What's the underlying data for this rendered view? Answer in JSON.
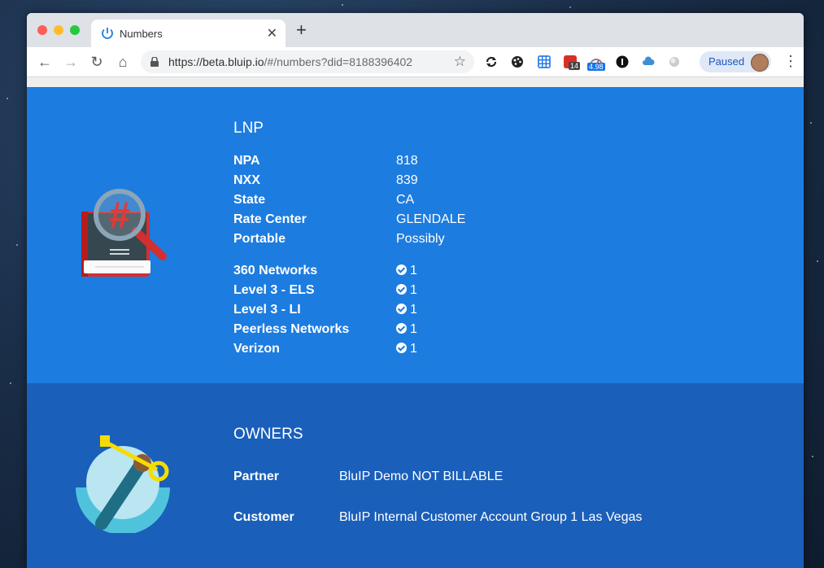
{
  "browser": {
    "tab_title": "Numbers",
    "url_host": "https://beta.bluip.io",
    "url_path": "/#/numbers?did=8188396402",
    "profile_status": "Paused",
    "extensions": [
      {
        "name": "sync-icon"
      },
      {
        "name": "palette-icon"
      },
      {
        "name": "grid-icon"
      },
      {
        "name": "calendar-icon",
        "badge": "14"
      },
      {
        "name": "gauge-icon",
        "badge": "4.98"
      },
      {
        "name": "onepassword-icon"
      },
      {
        "name": "cloud-icon"
      },
      {
        "name": "circle-icon"
      }
    ]
  },
  "lnp": {
    "title": "LNP",
    "fields": [
      {
        "label": "NPA",
        "value": "818"
      },
      {
        "label": "NXX",
        "value": "839"
      },
      {
        "label": "State",
        "value": "CA"
      },
      {
        "label": "Rate Center",
        "value": "GLENDALE"
      },
      {
        "label": "Portable",
        "value": "Possibly"
      }
    ],
    "carriers": [
      {
        "label": "360 Networks",
        "value": "1"
      },
      {
        "label": "Level 3 - ELS",
        "value": "1"
      },
      {
        "label": "Level 3 - LI",
        "value": "1"
      },
      {
        "label": "Peerless Networks",
        "value": "1"
      },
      {
        "label": "Verizon",
        "value": "1"
      }
    ]
  },
  "owners": {
    "title": "OWNERS",
    "partner_label": "Partner",
    "partner_value": "BluIP Demo NOT BILLABLE",
    "customer_label": "Customer",
    "customer_value": "BluIP Internal Customer Account Group 1 Las Vegas"
  },
  "colors": {
    "lnp_bg": "#1d7ce0",
    "owners_bg": "#1a5fba"
  }
}
